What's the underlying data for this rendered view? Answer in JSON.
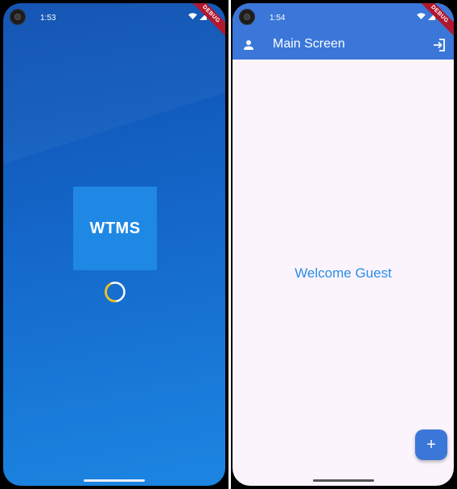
{
  "splash": {
    "status_time": "1:53",
    "debug_label": "DEBUG",
    "logo_text": "WTMS"
  },
  "main": {
    "status_time": "1:54",
    "debug_label": "DEBUG",
    "appbar": {
      "title": "Main Screen",
      "leading_icon": "person-icon",
      "action_icon": "login-icon"
    },
    "welcome_text": "Welcome Guest",
    "fab": {
      "icon": "add-icon",
      "label": "+"
    }
  },
  "colors": {
    "splash_gradient_top": "#0c4fb0",
    "splash_gradient_bottom": "#1c86e2",
    "logo_box": "#1f88e5",
    "spinner": "#f0c020",
    "appbar": "#3a77d9",
    "welcome_text": "#2b8ee6",
    "main_background": "#fbf4fd"
  }
}
